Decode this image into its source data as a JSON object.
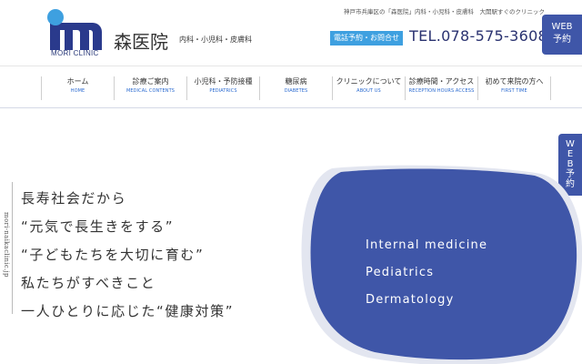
{
  "header": {
    "logo_text": "MORI CLINIC",
    "clinic_name": "森医院",
    "departments": "内科・小児科・皮膚科",
    "tagline": "神戸市兵庫区の「森医院」内科・小児科・皮膚科　大開駅すぐのクリニック",
    "contact_button": "電話予約・お問合せ",
    "phone": "TEL.078-575-3608",
    "web_reserve": {
      "line1": "WEB",
      "line2": "予約"
    }
  },
  "nav": [
    {
      "jp": "ホーム",
      "en": "HOME"
    },
    {
      "jp": "診療ご案内",
      "en": "MEDICAL CONTENTS"
    },
    {
      "jp": "小児科・予防接種",
      "en": "PEDIATRICS"
    },
    {
      "jp": "糖尿病",
      "en": "DIABETES"
    },
    {
      "jp": "クリニックについて",
      "en": "ABOUT US"
    },
    {
      "jp": "診療時間・アクセス",
      "en": "RECEPTION HOURS ACCESS"
    },
    {
      "jp": "初めて来院の方へ",
      "en": "FIRST TIME"
    }
  ],
  "side_tab": {
    "text": "WEB予約"
  },
  "vertical_url": "mori-naikaclinic.jp",
  "hero": {
    "lines": [
      "長寿社会だから",
      "“元気で長生きをする”",
      "“子どもたちを大切に育む”",
      "私たちがすべきこと",
      "一人ひとりに応じた“健康対策”"
    ],
    "specialties": [
      "Internal medicine",
      "Pediatrics",
      "Dermatology"
    ]
  },
  "colors": {
    "brand_navy": "#3f56a8",
    "accent_blue": "#3ea0e0",
    "logo_navy": "#2a3a8c",
    "logo_dot": "#3ea0e0"
  }
}
